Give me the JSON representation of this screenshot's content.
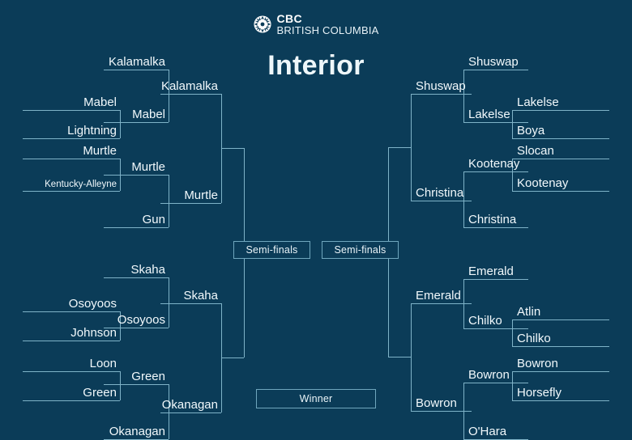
{
  "brand": {
    "logo_icon": "cbc-gem-icon",
    "line1": "CBC",
    "line2": "BRITISH COLUMBIA"
  },
  "page": {
    "title": "Interior",
    "background_color": "#0b3c58",
    "line_color": "#7fb3c8",
    "text_color": "#f2f9fc"
  },
  "stages": {
    "semifinal_left": "Semi-finals",
    "semifinal_right": "Semi-finals",
    "winner": "Winner"
  },
  "bracket": {
    "left": {
      "top_half": {
        "round1": [
          "Mabel",
          "Lightning",
          "Murtle",
          "Kentucky-Alleyne"
        ],
        "round2": [
          "Kalamalka",
          "Mabel",
          "Murtle",
          "Gun"
        ],
        "round3": [
          "Kalamalka",
          "Murtle"
        ]
      },
      "bottom_half": {
        "round1": [
          "Osoyoos",
          "Johnson",
          "Loon",
          "Green"
        ],
        "round2": [
          "Skaha",
          "Osoyoos",
          "Green",
          "Okanagan"
        ],
        "round3": [
          "Skaha",
          "Okanagan"
        ]
      }
    },
    "right": {
      "top_half": {
        "round1": [
          "Lakelse",
          "Boya",
          "Slocan",
          "Kootenay"
        ],
        "round2": [
          "Shuswap",
          "Lakelse",
          "Kootenay",
          "Christina"
        ],
        "round3": [
          "Shuswap",
          "Christina"
        ]
      },
      "bottom_half": {
        "round1": [
          "Atlin",
          "Chilko",
          "Bowron",
          "Horsefly"
        ],
        "round2": [
          "Emerald",
          "Chilko",
          "Bowron",
          "O'Hara"
        ],
        "round3": [
          "Emerald",
          "Bowron"
        ]
      }
    }
  },
  "labels": {
    "l_r1_1": "Mabel",
    "l_r1_2": "Lightning",
    "l_r1_3": "Murtle",
    "l_r1_4": "Kentucky-Alleyne",
    "l_r1_5": "Osoyoos",
    "l_r1_6": "Johnson",
    "l_r1_7": "Loon",
    "l_r1_8": "Green",
    "l_r2_1": "Kalamalka",
    "l_r2_2": "Mabel",
    "l_r2_3": "Murtle",
    "l_r2_4": "Gun",
    "l_r2_5": "Skaha",
    "l_r2_6": "Osoyoos",
    "l_r2_7": "Green",
    "l_r2_8": "Okanagan",
    "l_r3_1": "Kalamalka",
    "l_r3_2": "Murtle",
    "l_r3_3": "Skaha",
    "l_r3_4": "Okanagan",
    "r_r1_1": "Lakelse",
    "r_r1_2": "Boya",
    "r_r1_3": "Slocan",
    "r_r1_4": "Kootenay",
    "r_r1_5": "Atlin",
    "r_r1_6": "Chilko",
    "r_r1_7": "Bowron",
    "r_r1_8": "Horsefly",
    "r_r2_1": "Shuswap",
    "r_r2_2": "Lakelse",
    "r_r2_3": "Kootenay",
    "r_r2_4": "Christina",
    "r_r2_5": "Emerald",
    "r_r2_6": "Chilko",
    "r_r2_7": "Bowron",
    "r_r2_8": "O'Hara",
    "r_r3_1": "Shuswap",
    "r_r3_2": "Christina",
    "r_r3_3": "Emerald",
    "r_r3_4": "Bowron"
  }
}
